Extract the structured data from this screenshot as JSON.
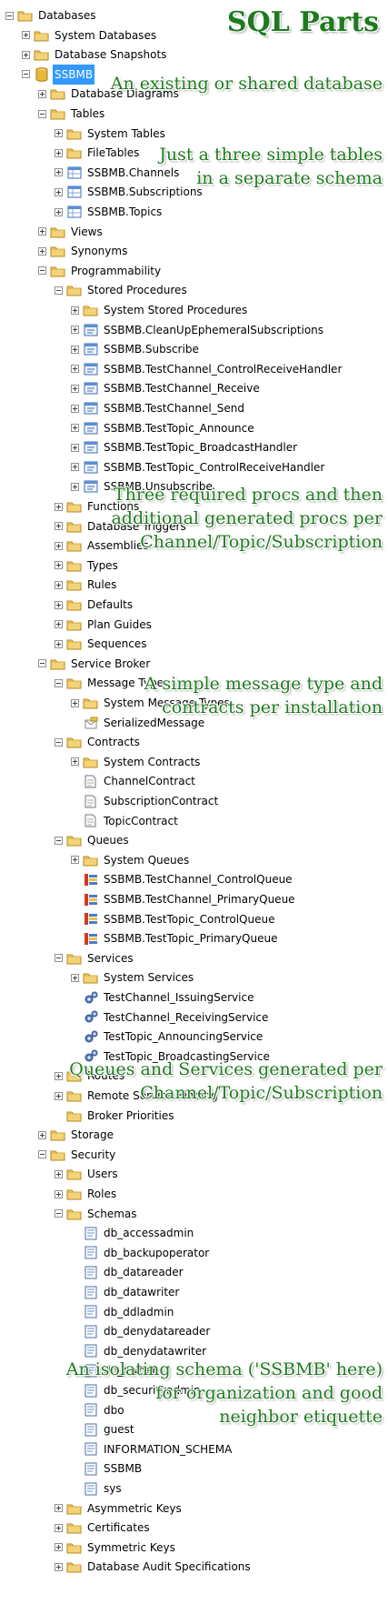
{
  "tree": [
    {
      "label": "Databases",
      "level": 0,
      "exp": "minus",
      "icon": "folder-icon"
    },
    {
      "label": "System Databases",
      "level": 1,
      "exp": "plus",
      "icon": "folder-icon"
    },
    {
      "label": "Database Snapshots",
      "level": 1,
      "exp": "plus",
      "icon": "folder-icon"
    },
    {
      "label": "SSBMB",
      "level": 1,
      "exp": "minus",
      "icon": "database-icon",
      "selected": true
    },
    {
      "label": "Database Diagrams",
      "level": 2,
      "exp": "plus",
      "icon": "folder-icon"
    },
    {
      "label": "Tables",
      "level": 2,
      "exp": "minus",
      "icon": "folder-icon"
    },
    {
      "label": "System Tables",
      "level": 3,
      "exp": "plus",
      "icon": "folder-icon"
    },
    {
      "label": "FileTables",
      "level": 3,
      "exp": "plus",
      "icon": "folder-icon"
    },
    {
      "label": "SSBMB.Channels",
      "level": 3,
      "exp": "plus",
      "icon": "table-icon"
    },
    {
      "label": "SSBMB.Subscriptions",
      "level": 3,
      "exp": "plus",
      "icon": "table-icon"
    },
    {
      "label": "SSBMB.Topics",
      "level": 3,
      "exp": "plus",
      "icon": "table-icon"
    },
    {
      "label": "Views",
      "level": 2,
      "exp": "plus",
      "icon": "folder-icon"
    },
    {
      "label": "Synonyms",
      "level": 2,
      "exp": "plus",
      "icon": "folder-icon"
    },
    {
      "label": "Programmability",
      "level": 2,
      "exp": "minus",
      "icon": "folder-icon"
    },
    {
      "label": "Stored Procedures",
      "level": 3,
      "exp": "minus",
      "icon": "folder-icon"
    },
    {
      "label": "System Stored Procedures",
      "level": 4,
      "exp": "plus",
      "icon": "folder-icon"
    },
    {
      "label": "SSBMB.CleanUpEphemeralSubscriptions",
      "level": 4,
      "exp": "plus",
      "icon": "procedure-icon"
    },
    {
      "label": "SSBMB.Subscribe",
      "level": 4,
      "exp": "plus",
      "icon": "procedure-icon"
    },
    {
      "label": "SSBMB.TestChannel_ControlReceiveHandler",
      "level": 4,
      "exp": "plus",
      "icon": "procedure-icon"
    },
    {
      "label": "SSBMB.TestChannel_Receive",
      "level": 4,
      "exp": "plus",
      "icon": "procedure-icon"
    },
    {
      "label": "SSBMB.TestChannel_Send",
      "level": 4,
      "exp": "plus",
      "icon": "procedure-icon"
    },
    {
      "label": "SSBMB.TestTopic_Announce",
      "level": 4,
      "exp": "plus",
      "icon": "procedure-icon"
    },
    {
      "label": "SSBMB.TestTopic_BroadcastHandler",
      "level": 4,
      "exp": "plus",
      "icon": "procedure-icon"
    },
    {
      "label": "SSBMB.TestTopic_ControlReceiveHandler",
      "level": 4,
      "exp": "plus",
      "icon": "procedure-icon"
    },
    {
      "label": "SSBMB.Unsubscribe",
      "level": 4,
      "exp": "plus",
      "icon": "procedure-icon"
    },
    {
      "label": "Functions",
      "level": 3,
      "exp": "plus",
      "icon": "folder-icon"
    },
    {
      "label": "Database Triggers",
      "level": 3,
      "exp": "plus",
      "icon": "folder-icon"
    },
    {
      "label": "Assemblies",
      "level": 3,
      "exp": "plus",
      "icon": "folder-icon"
    },
    {
      "label": "Types",
      "level": 3,
      "exp": "plus",
      "icon": "folder-icon"
    },
    {
      "label": "Rules",
      "level": 3,
      "exp": "plus",
      "icon": "folder-icon"
    },
    {
      "label": "Defaults",
      "level": 3,
      "exp": "plus",
      "icon": "folder-icon"
    },
    {
      "label": "Plan Guides",
      "level": 3,
      "exp": "plus",
      "icon": "folder-icon"
    },
    {
      "label": "Sequences",
      "level": 3,
      "exp": "plus",
      "icon": "folder-icon"
    },
    {
      "label": "Service Broker",
      "level": 2,
      "exp": "minus",
      "icon": "folder-icon"
    },
    {
      "label": "Message Types",
      "level": 3,
      "exp": "minus",
      "icon": "folder-icon"
    },
    {
      "label": "System Message Types",
      "level": 4,
      "exp": "plus",
      "icon": "folder-icon"
    },
    {
      "label": "SerializedMessage",
      "level": 4,
      "exp": "none",
      "icon": "message-type-icon"
    },
    {
      "label": "Contracts",
      "level": 3,
      "exp": "minus",
      "icon": "folder-icon"
    },
    {
      "label": "System Contracts",
      "level": 4,
      "exp": "plus",
      "icon": "folder-icon"
    },
    {
      "label": "ChannelContract",
      "level": 4,
      "exp": "none",
      "icon": "contract-icon"
    },
    {
      "label": "SubscriptionContract",
      "level": 4,
      "exp": "none",
      "icon": "contract-icon"
    },
    {
      "label": "TopicContract",
      "level": 4,
      "exp": "none",
      "icon": "contract-icon"
    },
    {
      "label": "Queues",
      "level": 3,
      "exp": "minus",
      "icon": "folder-icon"
    },
    {
      "label": "System Queues",
      "level": 4,
      "exp": "plus",
      "icon": "folder-icon"
    },
    {
      "label": "SSBMB.TestChannel_ControlQueue",
      "level": 4,
      "exp": "none",
      "icon": "queue-icon"
    },
    {
      "label": "SSBMB.TestChannel_PrimaryQueue",
      "level": 4,
      "exp": "none",
      "icon": "queue-icon"
    },
    {
      "label": "SSBMB.TestTopic_ControlQueue",
      "level": 4,
      "exp": "none",
      "icon": "queue-icon"
    },
    {
      "label": "SSBMB.TestTopic_PrimaryQueue",
      "level": 4,
      "exp": "none",
      "icon": "queue-icon"
    },
    {
      "label": "Services",
      "level": 3,
      "exp": "minus",
      "icon": "folder-icon"
    },
    {
      "label": "System Services",
      "level": 4,
      "exp": "plus",
      "icon": "folder-icon"
    },
    {
      "label": "TestChannel_IssuingService",
      "level": 4,
      "exp": "none",
      "icon": "service-icon"
    },
    {
      "label": "TestChannel_ReceivingService",
      "level": 4,
      "exp": "none",
      "icon": "service-icon"
    },
    {
      "label": "TestTopic_AnnouncingService",
      "level": 4,
      "exp": "none",
      "icon": "service-icon"
    },
    {
      "label": "TestTopic_BroadcastingService",
      "level": 4,
      "exp": "none",
      "icon": "service-icon"
    },
    {
      "label": "Routes",
      "level": 3,
      "exp": "plus",
      "icon": "folder-icon"
    },
    {
      "label": "Remote Service Binding",
      "level": 3,
      "exp": "plus",
      "icon": "folder-icon"
    },
    {
      "label": "Broker Priorities",
      "level": 3,
      "exp": "none",
      "icon": "folder-icon"
    },
    {
      "label": "Storage",
      "level": 2,
      "exp": "plus",
      "icon": "folder-icon"
    },
    {
      "label": "Security",
      "level": 2,
      "exp": "minus",
      "icon": "folder-icon"
    },
    {
      "label": "Users",
      "level": 3,
      "exp": "plus",
      "icon": "folder-icon"
    },
    {
      "label": "Roles",
      "level": 3,
      "exp": "plus",
      "icon": "folder-icon"
    },
    {
      "label": "Schemas",
      "level": 3,
      "exp": "minus",
      "icon": "folder-icon"
    },
    {
      "label": "db_accessadmin",
      "level": 4,
      "exp": "none",
      "icon": "schema-icon"
    },
    {
      "label": "db_backupoperator",
      "level": 4,
      "exp": "none",
      "icon": "schema-icon"
    },
    {
      "label": "db_datareader",
      "level": 4,
      "exp": "none",
      "icon": "schema-icon"
    },
    {
      "label": "db_datawriter",
      "level": 4,
      "exp": "none",
      "icon": "schema-icon"
    },
    {
      "label": "db_ddladmin",
      "level": 4,
      "exp": "none",
      "icon": "schema-icon"
    },
    {
      "label": "db_denydatareader",
      "level": 4,
      "exp": "none",
      "icon": "schema-icon"
    },
    {
      "label": "db_denydatawriter",
      "level": 4,
      "exp": "none",
      "icon": "schema-icon"
    },
    {
      "label": "db_owner",
      "level": 4,
      "exp": "none",
      "icon": "schema-icon"
    },
    {
      "label": "db_securityadmin",
      "level": 4,
      "exp": "none",
      "icon": "schema-icon"
    },
    {
      "label": "dbo",
      "level": 4,
      "exp": "none",
      "icon": "schema-icon"
    },
    {
      "label": "guest",
      "level": 4,
      "exp": "none",
      "icon": "schema-icon"
    },
    {
      "label": "INFORMATION_SCHEMA",
      "level": 4,
      "exp": "none",
      "icon": "schema-icon"
    },
    {
      "label": "SSBMB",
      "level": 4,
      "exp": "none",
      "icon": "schema-icon"
    },
    {
      "label": "sys",
      "level": 4,
      "exp": "none",
      "icon": "schema-icon"
    },
    {
      "label": "Asymmetric Keys",
      "level": 3,
      "exp": "plus",
      "icon": "folder-icon"
    },
    {
      "label": "Certificates",
      "level": 3,
      "exp": "plus",
      "icon": "folder-icon"
    },
    {
      "label": "Symmetric Keys",
      "level": 3,
      "exp": "plus",
      "icon": "folder-icon"
    },
    {
      "label": "Database Audit Specifications",
      "level": 3,
      "exp": "plus",
      "icon": "folder-icon"
    }
  ],
  "annotations": {
    "title": "SQL Parts",
    "existing_db": "An existing or shared database",
    "tables_1": "Just a three simple tables",
    "tables_2": "in a separate schema",
    "procs_1": "Three required procs and then",
    "procs_2": "additional generated procs per",
    "procs_3": "Channel/Topic/Subscription",
    "msg_1": "A simple message type and",
    "msg_2": "contracts per installation",
    "queues_1": "Queues and Services generated per",
    "queues_2": "Channel/Topic/Subscription",
    "schema_1": "An isolating schema ('SSBMB' here)",
    "schema_2": "for organization and good",
    "schema_3": "neighbor etiquette"
  },
  "colors": {
    "annotation": "#1f7a1f",
    "selection": "#3399ff",
    "folder": "#e8c45a",
    "database": "#d9a520"
  }
}
